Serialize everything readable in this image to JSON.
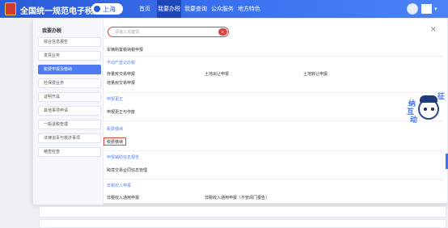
{
  "header": {
    "site_title": "全国统一规范电子税务局",
    "region": "上海",
    "nav": [
      {
        "label": "首页",
        "active": false
      },
      {
        "label": "我要办税",
        "active": true
      },
      {
        "label": "我要查询",
        "active": false
      },
      {
        "label": "公众服务",
        "active": false
      },
      {
        "label": "地方特色",
        "active": false
      }
    ],
    "colors": {
      "bar": "#3d74f2",
      "active": "#1f47b8"
    }
  },
  "sidebar": {
    "heading": "我要办税",
    "items": [
      {
        "label": "综合信息报告",
        "selected": false
      },
      {
        "label": "发票业务",
        "selected": false
      },
      {
        "label": "税费申报及缴纳",
        "selected": true
      },
      {
        "label": "社保费业务",
        "selected": false
      },
      {
        "label": "证明开具",
        "selected": false
      },
      {
        "label": "其他事项申请",
        "selected": false
      },
      {
        "label": "一般退税管理",
        "selected": false
      },
      {
        "label": "法律追责与救济事项",
        "selected": false
      },
      {
        "label": "稽查检查",
        "selected": false
      }
    ]
  },
  "search": {
    "placeholder": "请输入关键词",
    "button_icon": "search-icon"
  },
  "content": {
    "vehicle_link": "车辆购置税纳税申报",
    "sections": {
      "property": "不动产登记办税",
      "correction": "申报更正",
      "pay": "税费缴纳",
      "contract": "申报辅助信息报告",
      "nontax": "非税收入申报"
    },
    "links": {
      "stock_house": "存量房交易申报",
      "land_out": "土地出让申报",
      "land_transfer": "土地转让申报",
      "incremental_house": "增量房交易申报",
      "correct_void": "申报更正与作废",
      "tax_payment": "税费缴纳",
      "contract_info": "跨境交易合同信息管理",
      "nontax_general": "非税收入通用申报",
      "nontax_other": "非税收入通用申报（不管闲门报告）"
    }
  },
  "mascot": {
    "chars": [
      "征",
      "纳",
      "互",
      "动"
    ]
  }
}
